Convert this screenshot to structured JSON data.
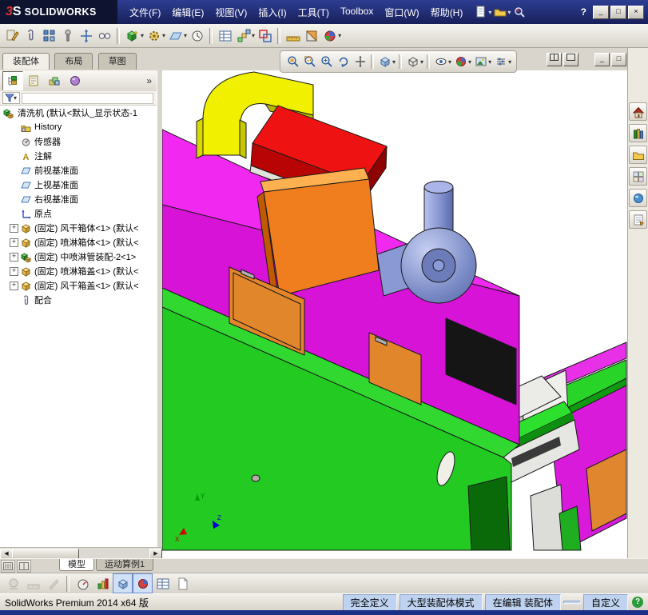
{
  "titlebar": {
    "logo_mark_3": "3",
    "logo_mark_s": "S",
    "logo_text": "SOLIDWORKS",
    "menus": [
      "文件(F)",
      "编辑(E)",
      "视图(V)",
      "插入(I)",
      "工具(T)",
      "Toolbox",
      "窗口(W)",
      "帮助(H)"
    ],
    "help_glyph": "?",
    "window_controls": {
      "minimize": "_",
      "maximize": "□",
      "close": "×"
    }
  },
  "command_tabs": {
    "items": [
      "装配体",
      "布局",
      "草图"
    ],
    "active": "装配体"
  },
  "glyphs": {
    "caret": "▾",
    "expand": "+",
    "overflow": "»",
    "scroll_left": "◀",
    "scroll_right": "▶"
  },
  "panel": {
    "annotation_letter": "A",
    "root_label": "清洗机 (默认<默认_显示状态-1",
    "items": [
      {
        "label": "History"
      },
      {
        "label": "传感器"
      },
      {
        "label": "注解"
      },
      {
        "label": "前视基准面"
      },
      {
        "label": "上视基准面"
      },
      {
        "label": "右视基准面"
      },
      {
        "label": "原点"
      },
      {
        "label": "(固定) 风干箱体<1> (默认<"
      },
      {
        "label": "(固定) 喷淋箱体<1> (默认<"
      },
      {
        "label": "(固定) 中喷淋管装配-2<1>"
      },
      {
        "label": "(固定) 喷淋箱盖<1> (默认<"
      },
      {
        "label": "(固定) 风干箱盖<1> (默认<"
      },
      {
        "label": "配合"
      }
    ]
  },
  "viewport": {
    "triad": {
      "x": "X",
      "y": "Y",
      "z": "Z"
    }
  },
  "bottom_tabs": {
    "items": [
      "模型",
      "运动算例1"
    ],
    "active": "模型"
  },
  "statusbar": {
    "left": "SolidWorks Premium 2014 x64 版",
    "fully_defined": "完全定义",
    "assembly_mode": "大型装配体模式",
    "editing": "在编辑 装配体",
    "custom": "自定义",
    "help_glyph": "?"
  },
  "colors": {
    "base_green": "#22ca22",
    "housing_magenta": "#d813d8",
    "duct_yellow": "#f0f000",
    "box_red": "#ee1212",
    "box_orange": "#f07e1e",
    "blower_blue": "#8a98d4",
    "titlebar_blue": "#1c2f86"
  }
}
